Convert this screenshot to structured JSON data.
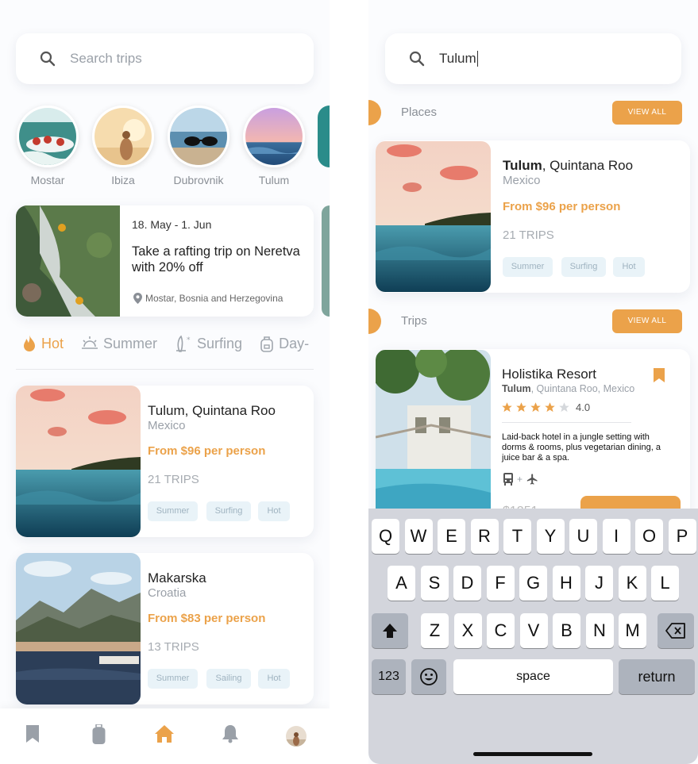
{
  "left": {
    "search_placeholder": "Search trips",
    "destinations": [
      {
        "name": "Mostar"
      },
      {
        "name": "Ibiza"
      },
      {
        "name": "Dubrovnik"
      },
      {
        "name": "Tulum"
      }
    ],
    "promo": {
      "dates": "18. May - 1. Jun",
      "title": "Take a rafting trip on Neretva with 20% off",
      "location": "Mostar, Bosnia and Herzegovina"
    },
    "tabs": [
      {
        "label": "Hot",
        "icon": "flame-icon",
        "active": true
      },
      {
        "label": "Summer",
        "icon": "sun-icon"
      },
      {
        "label": "Surfing",
        "icon": "surfboard-icon"
      },
      {
        "label": "Day-",
        "icon": "backpack-icon"
      }
    ],
    "results": [
      {
        "title_bold": "Tulum, Quintana Roo",
        "subtitle": "Mexico",
        "price": "From $96 per person",
        "trips": "21 TRIPS",
        "tags": [
          "Summer",
          "Surfing",
          "Hot"
        ]
      },
      {
        "title_bold": "Makarska",
        "subtitle": "Croatia",
        "price": "From $83 per person",
        "trips": "13 TRIPS",
        "tags": [
          "Summer",
          "Sailing",
          "Hot"
        ]
      }
    ],
    "nav": [
      "bookmark-icon",
      "luggage-icon",
      "home-icon",
      "bell-icon",
      "avatar"
    ]
  },
  "right": {
    "search_value": "Tulum",
    "places": {
      "section": "Places",
      "view_all": "VIEW ALL",
      "card": {
        "title_bold": "Tulum",
        "title_rest": ", Quintana Roo",
        "subtitle": "Mexico",
        "price": "From $96 per person",
        "trips": "21 TRIPS",
        "tags": [
          "Summer",
          "Surfing",
          "Hot"
        ]
      }
    },
    "trips": {
      "section": "Trips",
      "view_all": "VIEW ALL",
      "card": {
        "title": "Holistika Resort",
        "loc_bold": "Tulum",
        "loc_rest": ", Quintana Roo, Mexico",
        "rating": "4.0",
        "stars": 4,
        "description": "Laid-back hotel in a jungle setting with dorms & rooms, plus vegetarian dining, a juice bar & a spa.",
        "price_partial": "$1251"
      }
    },
    "keyboard": {
      "row1": [
        "Q",
        "W",
        "E",
        "R",
        "T",
        "Y",
        "U",
        "I",
        "O",
        "P"
      ],
      "row2": [
        "A",
        "S",
        "D",
        "F",
        "G",
        "H",
        "J",
        "K",
        "L"
      ],
      "row3": [
        "Z",
        "X",
        "C",
        "V",
        "B",
        "N",
        "M"
      ],
      "num": "123",
      "space": "space",
      "return": "return"
    }
  },
  "colors": {
    "accent": "#eba24a",
    "chip_bg": "#e9f3f8",
    "chip_text": "#9fb3c0"
  }
}
